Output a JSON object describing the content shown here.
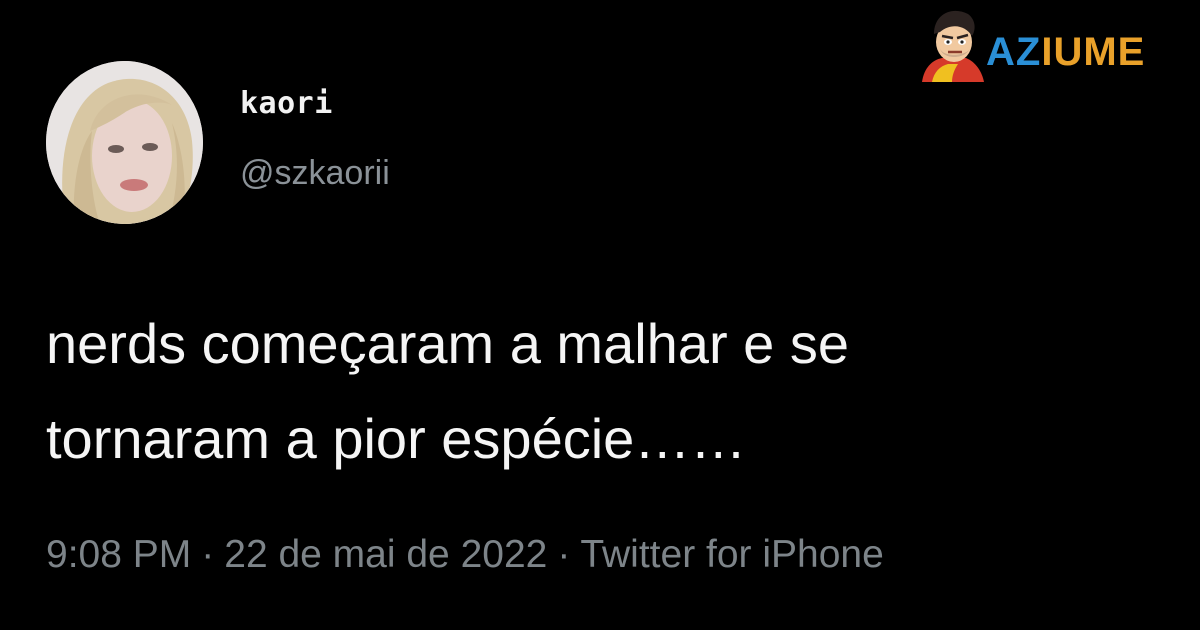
{
  "tweet": {
    "display_name": "kaori",
    "handle": "@szkaorii",
    "text_lines": [
      "nerds começaram a malhar e se",
      "tornaram a pior espécie……"
    ],
    "time": "9:08 PM",
    "date": "22 de mai de 2022",
    "source": "Twitter for iPhone",
    "separator": "·"
  },
  "watermark": {
    "logo_part_a": "AZ",
    "logo_part_b": "IUME",
    "mascot_icon": "cartoon-face-icon",
    "colors": {
      "part_a": "#2a8fd6",
      "part_b": "#e9a12a"
    }
  },
  "colors": {
    "background": "#000000",
    "text": "#f5f5f5",
    "muted": "#7d8489"
  }
}
